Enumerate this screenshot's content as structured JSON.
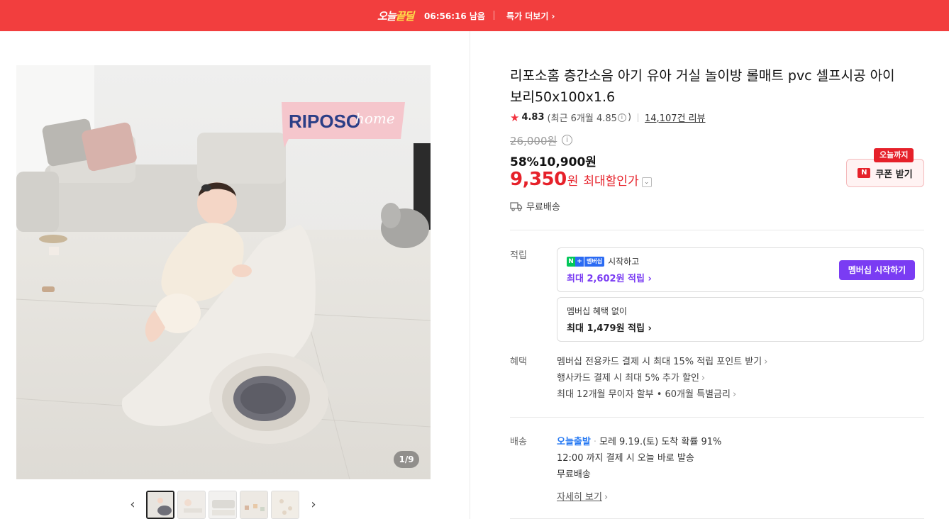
{
  "top_banner": {
    "deal_logo_main": "오늘",
    "deal_logo_accent": "끝딜",
    "countdown": "06:56:16 남음",
    "more_link": "특가 더보기 ›"
  },
  "gallery": {
    "brand_watermark": "RIPOSO home",
    "counter_current": "1",
    "counter_total": "/9",
    "thumb_count": 5,
    "active_thumb_index": 0,
    "prev_arrow": "‹",
    "next_arrow": "›"
  },
  "product": {
    "title": "리포소홈 층간소음 아기 유아 거실 놀이방 롤매트 pvc 셀프시공 아이보리50x100x1.6",
    "rating_score": "4.83",
    "rating_recent": "(최근 6개월 4.85",
    "rating_recent_close": ")",
    "review_count": "14,107건 리뷰",
    "original_price": "26,000원",
    "discount_sale_price": "58%10,900원",
    "max_discount_price_num": "9,350",
    "max_discount_price_unit": "원",
    "max_discount_label": "최대할인가",
    "shipping_fee": "무료배송"
  },
  "coupon": {
    "tag": "오늘까지",
    "badge": "N",
    "label": "쿠폰 받기"
  },
  "points": {
    "section_label": "적립",
    "membership_intro": "시작하고",
    "membership_badge": "멤버십",
    "membership_amount": "최대 2,602원 적립 ›",
    "membership_button": "멤버십 시작하기",
    "no_membership_intro": "멤버십 혜택 없이",
    "no_membership_amount": "최대 1,479원 적립 ›"
  },
  "benefits": {
    "section_label": "혜택",
    "items": [
      "멤버십 전용카드 결제 시 최대 15% 적립 포인트 받기",
      "행사카드 결제 시 최대 5% 추가 할인",
      "최대 12개월 무이자 할부 • 60개월 특별금리"
    ]
  },
  "delivery": {
    "section_label": "배송",
    "express_label": "오늘출발",
    "arrival": "모레 9.19.(토) 도착 확률 91%",
    "cutoff": "12:00 까지 결제 시 오늘 바로 발송",
    "fee": "무료배송",
    "detail_link": "자세히 보기"
  },
  "colors": {
    "banner_red": "#f23e3e",
    "price_red": "#e6212a",
    "membership_purple": "#7a3cf3",
    "express_blue": "#2b7cf3"
  }
}
